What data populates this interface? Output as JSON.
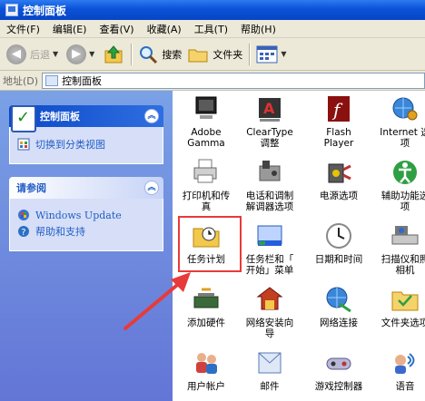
{
  "window": {
    "title": "控制面板"
  },
  "menu": [
    "文件(F)",
    "编辑(E)",
    "查看(V)",
    "收藏(A)",
    "工具(T)",
    "帮助(H)"
  ],
  "toolbar": {
    "back": "后退",
    "search": "搜索",
    "folders": "文件夹"
  },
  "address": {
    "label": "地址(D)",
    "value": "控制面板"
  },
  "sidebar": {
    "panel1": {
      "title": "控制面板",
      "link": "切换到分类视图"
    },
    "panel2": {
      "title": "请参阅",
      "links": [
        "Windows Update",
        "帮助和支持"
      ]
    }
  },
  "items": [
    {
      "label": "Adobe Gamma",
      "icon": "adobe-gamma-icon"
    },
    {
      "label": "ClearType\n调整",
      "icon": "cleartype-icon"
    },
    {
      "label": "Flash\nPlayer",
      "icon": "flash-icon"
    },
    {
      "label": "Internet 选\n项",
      "icon": "internet-options-icon"
    },
    {
      "label": "打印机和传\n真",
      "icon": "printer-icon"
    },
    {
      "label": "电话和调制\n解调器选项",
      "icon": "phone-modem-icon"
    },
    {
      "label": "电源选项",
      "icon": "power-icon"
    },
    {
      "label": "辅助功能选\n项",
      "icon": "accessibility-icon"
    },
    {
      "label": "任务计划",
      "icon": "scheduled-tasks-icon"
    },
    {
      "label": "任务栏和「\n开始」菜单",
      "icon": "taskbar-icon"
    },
    {
      "label": "日期和时间",
      "icon": "clock-icon"
    },
    {
      "label": "扫描仪和照\n相机",
      "icon": "scanner-icon"
    },
    {
      "label": "添加硬件",
      "icon": "add-hardware-icon"
    },
    {
      "label": "网络安装向\n导",
      "icon": "network-setup-icon"
    },
    {
      "label": "网络连接",
      "icon": "network-connections-icon"
    },
    {
      "label": "文件夹选项",
      "icon": "folder-options-icon"
    },
    {
      "label": "用户帐户",
      "icon": "user-accounts-icon"
    },
    {
      "label": "邮件",
      "icon": "mail-icon"
    },
    {
      "label": "游戏控制器",
      "icon": "game-controller-icon"
    },
    {
      "label": "语音",
      "icon": "speech-icon"
    }
  ],
  "colors": {
    "titlebar": "#0a52d8",
    "taskpane": "#6f8ee0",
    "highlight": "#e83a3a",
    "link": "#215dc6"
  }
}
